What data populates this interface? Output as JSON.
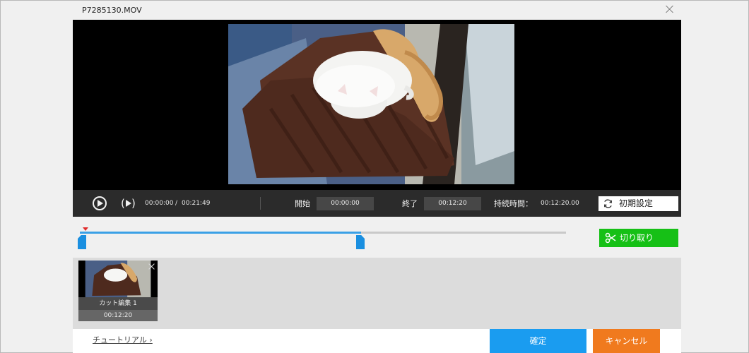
{
  "window": {
    "title": "P7285130.MOV",
    "close_icon": "close-icon"
  },
  "player": {
    "frame_description_icon": "video-frame"
  },
  "controls": {
    "play_icon": "play-icon",
    "step_icon": "step-forward-icon",
    "current_time": "00:00:00",
    "separator": "/",
    "total_time": "00:21:49",
    "start_label": "開始",
    "start_value": "00:00:00",
    "end_label": "終了",
    "end_value": "00:12:20",
    "duration_label": "持続時間：",
    "duration_value": "00:12:20.00",
    "reset_label": "初期設定",
    "reset_icon": "refresh-icon"
  },
  "timeline": {
    "selection_start_fraction": 0.0,
    "selection_end_fraction": 0.565,
    "playhead_fraction": 0.0,
    "cut_label": "切り取り",
    "cut_icon": "scissors-icon",
    "colors": {
      "track": "#c9c9c9",
      "selection": "#3aa0e6",
      "playhead": "#e02b2b",
      "cut_button": "#16c016"
    }
  },
  "clips": [
    {
      "name": "カット編集 1",
      "duration": "00:12:20",
      "close_icon": "close-icon"
    }
  ],
  "footer": {
    "tutorial_label": "チュートリアル ›",
    "confirm_label": "確定",
    "cancel_label": "キャンセル",
    "colors": {
      "confirm": "#1a9cf0",
      "cancel": "#f07a1e"
    }
  }
}
